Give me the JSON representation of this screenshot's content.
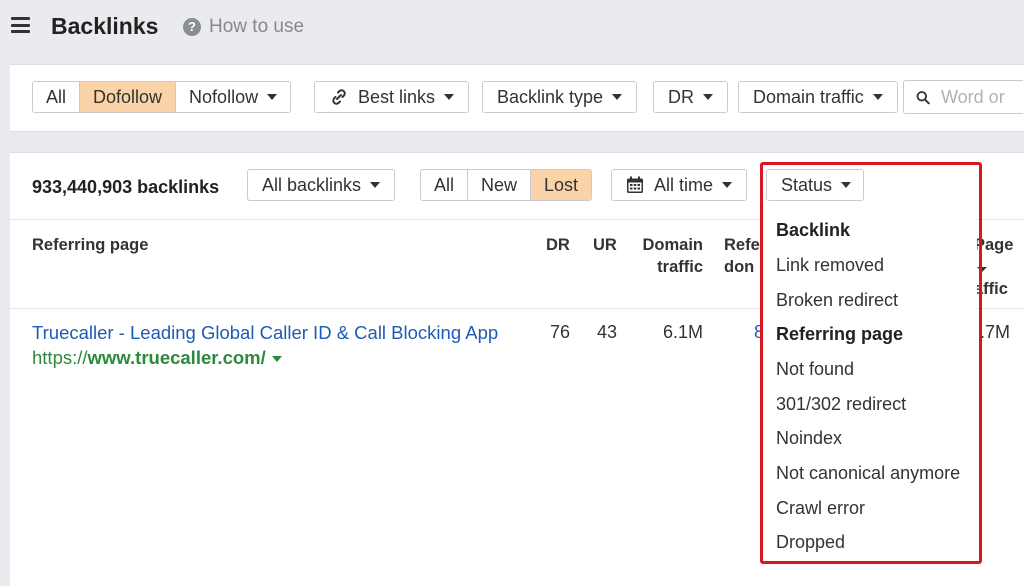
{
  "header": {
    "title": "Backlinks",
    "help_icon": "question-circle-icon",
    "help_label": "How to use"
  },
  "filters": {
    "link_attr": {
      "options": [
        "All",
        "Dofollow",
        "Nofollow"
      ],
      "selected": "Dofollow"
    },
    "best_links_label": "Best links",
    "backlink_type_label": "Backlink type",
    "dr_label": "DR",
    "domain_traffic_label": "Domain traffic",
    "search_placeholder": "Word or"
  },
  "toolbar": {
    "count_label": "933,440,903 backlinks",
    "all_backlinks_label": "All backlinks",
    "status_seg": {
      "options": [
        "All",
        "New",
        "Lost"
      ],
      "selected": "Lost"
    },
    "all_time_label": "All time",
    "status_label": "Status"
  },
  "table": {
    "headers": {
      "referring_page": "Referring page",
      "dr": "DR",
      "ur": "UR",
      "domain_traffic_1": "Domain",
      "domain_traffic_2": "traffic",
      "referring_domains_1": "Refe",
      "referring_domains_2": "don",
      "page_traffic_1": "Page",
      "page_traffic_2": "affic"
    },
    "rows": [
      {
        "title": "Truecaller - Leading Global Caller ID & Call Blocking App",
        "url_prefix": "https://",
        "url_domain": "www.truecaller.com/",
        "dr": "76",
        "ur": "43",
        "domain_traffic": "6.1M",
        "referring_domains": "8",
        "page_traffic": ".7M"
      }
    ]
  },
  "status_dropdown": {
    "backlink_heading": "Backlink",
    "backlink_items": [
      "Link removed",
      "Broken redirect"
    ],
    "referring_heading": "Referring page",
    "referring_items": [
      "Not found",
      "301/302 redirect",
      "Noindex",
      "Not canonical anymore",
      "Crawl error",
      "Dropped"
    ]
  },
  "colors": {
    "active_segment": "#fbd3a8",
    "link": "#1f5bb5",
    "url": "#2c8a3b",
    "highlight": "#d8181e"
  }
}
